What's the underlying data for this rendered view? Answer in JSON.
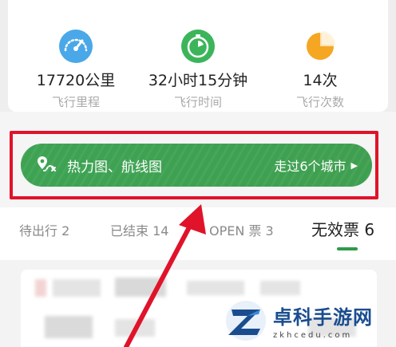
{
  "stats": [
    {
      "value": "17720公里",
      "label": "飞行里程",
      "icon": "speedometer-icon",
      "color": "#4aa8e8"
    },
    {
      "value": "32小时15分钟",
      "label": "飞行时间",
      "icon": "timer-icon",
      "color": "#3cb55a"
    },
    {
      "value": "14次",
      "label": "飞行次数",
      "icon": "pie-chart-icon",
      "color": "#f5a623"
    }
  ],
  "banner": {
    "title": "热力图、航线图",
    "right_text": "走过6个城市",
    "chevron": "▶",
    "icon": "route-map-icon",
    "color": "#3da353"
  },
  "tabs": [
    {
      "label": "待出行 2"
    },
    {
      "label": "已结束 14"
    },
    {
      "label": "OPEN 票 3"
    },
    {
      "label": "无效票 6",
      "active": true
    }
  ],
  "accent": "#2e9b4a",
  "highlight_color": "#e0132a",
  "watermark": {
    "title": "卓科手游网",
    "url": "zkhcedu.com"
  }
}
